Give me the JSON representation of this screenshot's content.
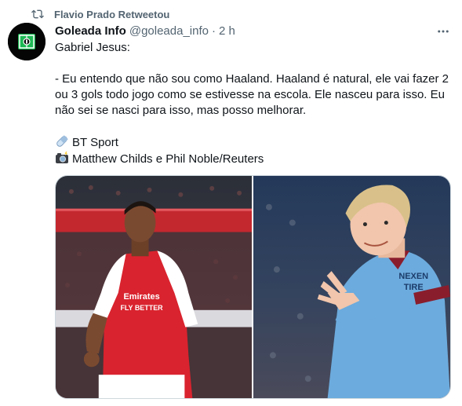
{
  "retweet": {
    "icon": "retweet-icon",
    "label": "Flavio Prado Retweetou"
  },
  "tweet": {
    "author_name": "Goleada Info",
    "handle": "@goleada_info",
    "separator": "·",
    "time": "2 h",
    "more_icon": "more-options-icon",
    "avatar_icon": "goleada-logo-icon",
    "text": {
      "line1": "Gabriel Jesus:",
      "quote": "- Eu entendo que não sou como Haaland. Haaland é natural, ele vai fazer 2 ou 3 gols todo jogo como se estivesse na escola. Ele nasceu para isso. Eu não sei se nasci para isso, mas posso melhorar.",
      "source_icon": "pill-emoji-icon",
      "source": "BT Sport",
      "photo_icon": "camera-flash-emoji-icon",
      "photo_credit": "Matthew Childs e Phil Noble/Reuters"
    },
    "media": {
      "photos": [
        {
          "name": "gabriel-jesus-arsenal-photo",
          "shirt_sponsor": "Emirates FLY BETTER"
        },
        {
          "name": "haaland-manchester-city-photo",
          "shirt_sponsor": "NEXEN TIRE"
        }
      ]
    }
  },
  "colors": {
    "text": "#0f1419",
    "secondary": "#536471",
    "border": "#cfd9de",
    "arsenal_red": "#d9232e",
    "city_blue": "#6cabdd"
  }
}
